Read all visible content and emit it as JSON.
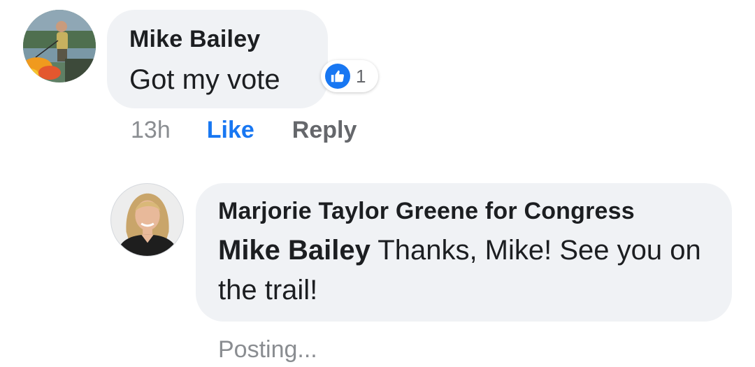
{
  "comment": {
    "author": "Mike Bailey",
    "text": "Got my vote",
    "reaction_count": "1",
    "timestamp": "13h",
    "like_label": "Like",
    "reply_label": "Reply",
    "avatar_icon": "user-photo"
  },
  "reply": {
    "author": "Marjorie Taylor Greene for Congress",
    "mention": "Mike Bailey",
    "text": " Thanks, Mike! See you on the trail!",
    "status": "Posting...",
    "avatar_icon": "user-photo"
  },
  "colors": {
    "bubble": "#f0f2f5",
    "accent": "#1877f2",
    "secondary_text": "#65676b",
    "muted_text": "#8a8d91"
  }
}
